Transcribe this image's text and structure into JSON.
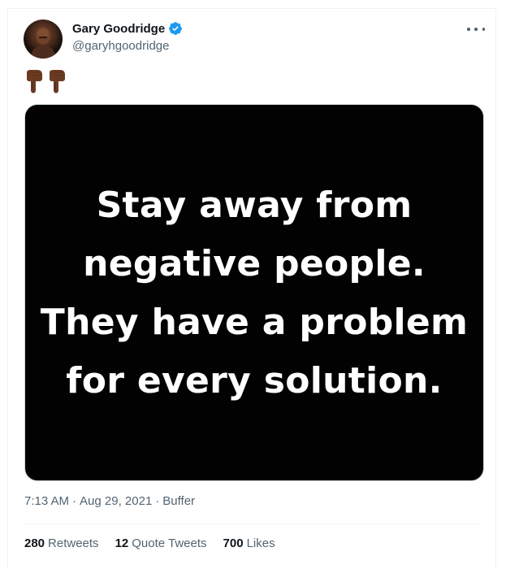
{
  "author": {
    "display_name": "Gary Goodridge",
    "handle": "@garyhgoodridge",
    "verified": true
  },
  "tweet": {
    "emojis": [
      "backhand-index-pointing-down-dark-skin",
      "backhand-index-pointing-down-dark-skin"
    ],
    "image_text_lines": [
      "Stay away from",
      "negative people.",
      "They have a problem",
      "for every solution."
    ]
  },
  "meta": {
    "time": "7:13 AM",
    "separator": "·",
    "date": "Aug 29, 2021",
    "source": "Buffer"
  },
  "stats": {
    "retweets": {
      "count": "280",
      "label": "Retweets"
    },
    "quote_tweets": {
      "count": "12",
      "label": "Quote Tweets"
    },
    "likes": {
      "count": "700",
      "label": "Likes"
    }
  },
  "colors": {
    "verified_badge": "#1d9bf0",
    "secondary_text": "#536471",
    "primary_text": "#0f1419",
    "image_background": "#020202",
    "emoji_skin": "#6b3b21"
  }
}
